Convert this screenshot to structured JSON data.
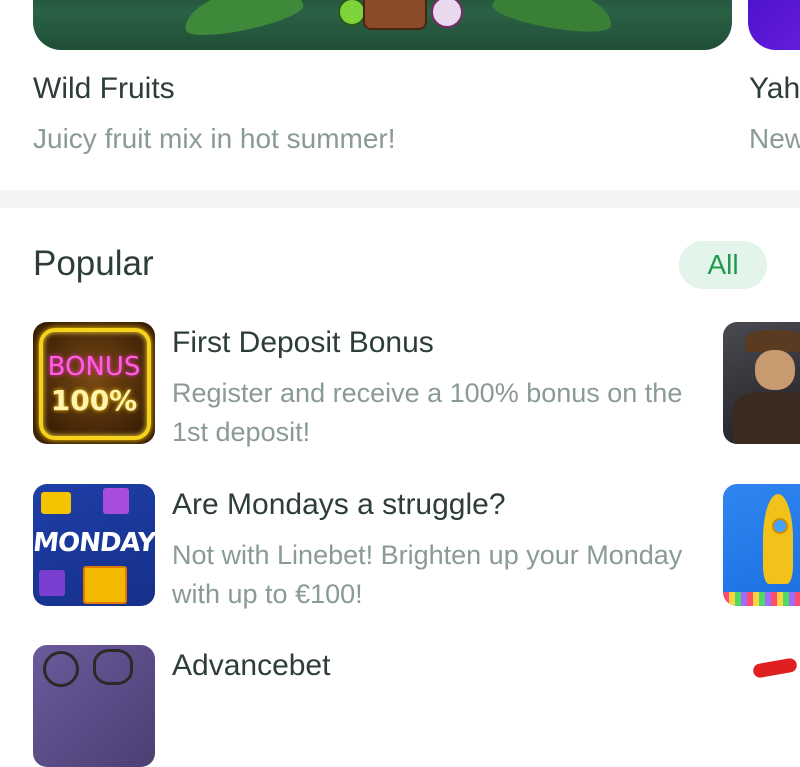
{
  "featured": {
    "cards": [
      {
        "title": "Wild Fruits",
        "subtitle": "Juicy fruit mix in hot summer!"
      },
      {
        "title": "Yah",
        "subtitle": "New"
      }
    ]
  },
  "popular": {
    "title": "Popular",
    "all_label": "All",
    "items": [
      {
        "title": "First Deposit Bonus",
        "description": "Register and receive a 100% bonus on the 1st deposit!",
        "thumb_text_1": "BONUS",
        "thumb_text_2": "100%"
      },
      {
        "title": "Are Mondays a struggle?",
        "description": "Not with Linebet! Brighten up your Monday with up to €100!",
        "thumb_text_1": "MONDAY"
      },
      {
        "title": "Advancebet",
        "description": ""
      }
    ]
  },
  "colors": {
    "accent": "#1f9a4c",
    "title_text": "#2c3e36",
    "secondary_text": "#8a9a94"
  }
}
